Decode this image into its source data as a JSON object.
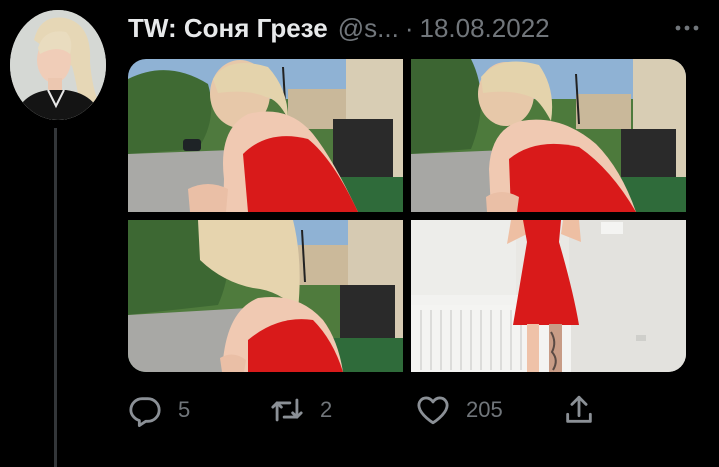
{
  "tweet": {
    "author_name": "TW: Соня Грезе",
    "author_handle": "@s...",
    "separator": "·",
    "date": "18.08.2022"
  },
  "icons": {
    "more": "more-horizontal-icon",
    "reply": "reply-icon",
    "retweet": "retweet-icon",
    "like": "heart-icon",
    "share": "share-icon"
  },
  "actions": {
    "reply_count": "5",
    "retweet_count": "2",
    "like_count": "205"
  },
  "colors": {
    "background": "#000000",
    "text": "#e7e9ea",
    "muted": "#71767b",
    "dress_red": "#d91a1a"
  }
}
